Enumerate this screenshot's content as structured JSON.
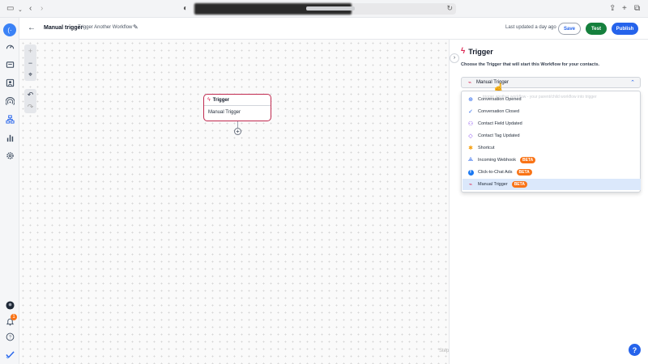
{
  "header": {
    "workflow_name": "Manual trigger",
    "workflow_description": "Trigger Another Workflow",
    "last_updated": "Last updated a day ago",
    "save_label": "Save",
    "test_label": "Test",
    "publish_label": "Publish"
  },
  "canvas": {
    "node": {
      "title": "Trigger",
      "body": "Manual Trigger"
    },
    "steps_label": "Steps"
  },
  "panel": {
    "title": "Trigger",
    "subtitle": "Choose the Trigger that will start this Workflow for your contacts.",
    "selected_value": "Manual Trigger",
    "ghost_text": "trigger another workflow - your parent/child workflow into trigger",
    "options": [
      {
        "label": "Conversation Opened",
        "icon": "message-icon",
        "badge": ""
      },
      {
        "label": "Conversation Closed",
        "icon": "check-circle-icon",
        "badge": ""
      },
      {
        "label": "Contact Field Updated",
        "icon": "contact-icon",
        "badge": ""
      },
      {
        "label": "Contact Tag Updated",
        "icon": "tag-icon",
        "badge": ""
      },
      {
        "label": "Shortcut",
        "icon": "shortcut-icon",
        "badge": ""
      },
      {
        "label": "Incoming Webhook",
        "icon": "webhook-icon",
        "badge": "BETA"
      },
      {
        "label": "Click-to-Chat Ads",
        "icon": "facebook-icon",
        "badge": "BETA"
      },
      {
        "label": "Manual Trigger",
        "icon": "manual-trigger-icon",
        "badge": "BETA"
      }
    ]
  },
  "sidebar": {
    "notification_count": "1"
  },
  "colors": {
    "accent": "#2563eb",
    "trigger": "#dc2651",
    "test_green": "#15803d",
    "beta_orange": "#f97316"
  }
}
